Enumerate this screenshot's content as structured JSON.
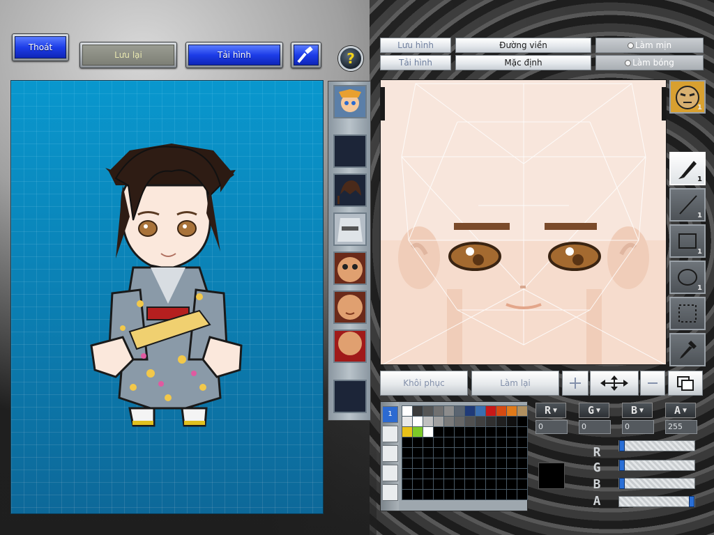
{
  "toolbar": {
    "exit_label": "Thoát",
    "save_label": "Lưu lại",
    "load_label": "Tải hình",
    "hammer_icon": "hammer-icon",
    "help_label": "?"
  },
  "canvas_tabs": {
    "save_image": "Lưu hình",
    "load_image": "Tải hình",
    "outline": "Đường viền",
    "default": "Mặc định",
    "smooth": "Làm mịn",
    "shade": "Làm bóng"
  },
  "tools": {
    "pen_count": "1",
    "line_count": "1",
    "rect_count": "1",
    "ellipse_count": "1",
    "badge_count": "1"
  },
  "actions": {
    "restore": "Khôi phục",
    "redo": "Làm lại"
  },
  "palette": {
    "active_tab": "1",
    "colors": [
      "#ffffff",
      "#3a3a3a",
      "#555555",
      "#707070",
      "#8c8c8c",
      "#5a6470",
      "#1f3a78",
      "#3b6fb0",
      "#c81818",
      "#d64a12",
      "#e07a1a",
      "#b09060",
      "#e8e8e8",
      "#ffffff",
      "#c0c0c0",
      "#a0a0a0",
      "#7a7a7a",
      "#666666",
      "#505050",
      "#404040",
      "#303030",
      "#202020",
      "#101010",
      "#000000",
      "#e8c018",
      "#7cc828",
      "#ffffff"
    ]
  },
  "channels": {
    "r": {
      "label": "R",
      "value": "0"
    },
    "g": {
      "label": "G",
      "value": "0"
    },
    "b": {
      "label": "B",
      "value": "0"
    },
    "a": {
      "label": "A",
      "value": "255"
    }
  },
  "colors": {
    "selected": "#000000",
    "preview_bg": "#1480b0",
    "accent_blue": "#1d3de8"
  }
}
